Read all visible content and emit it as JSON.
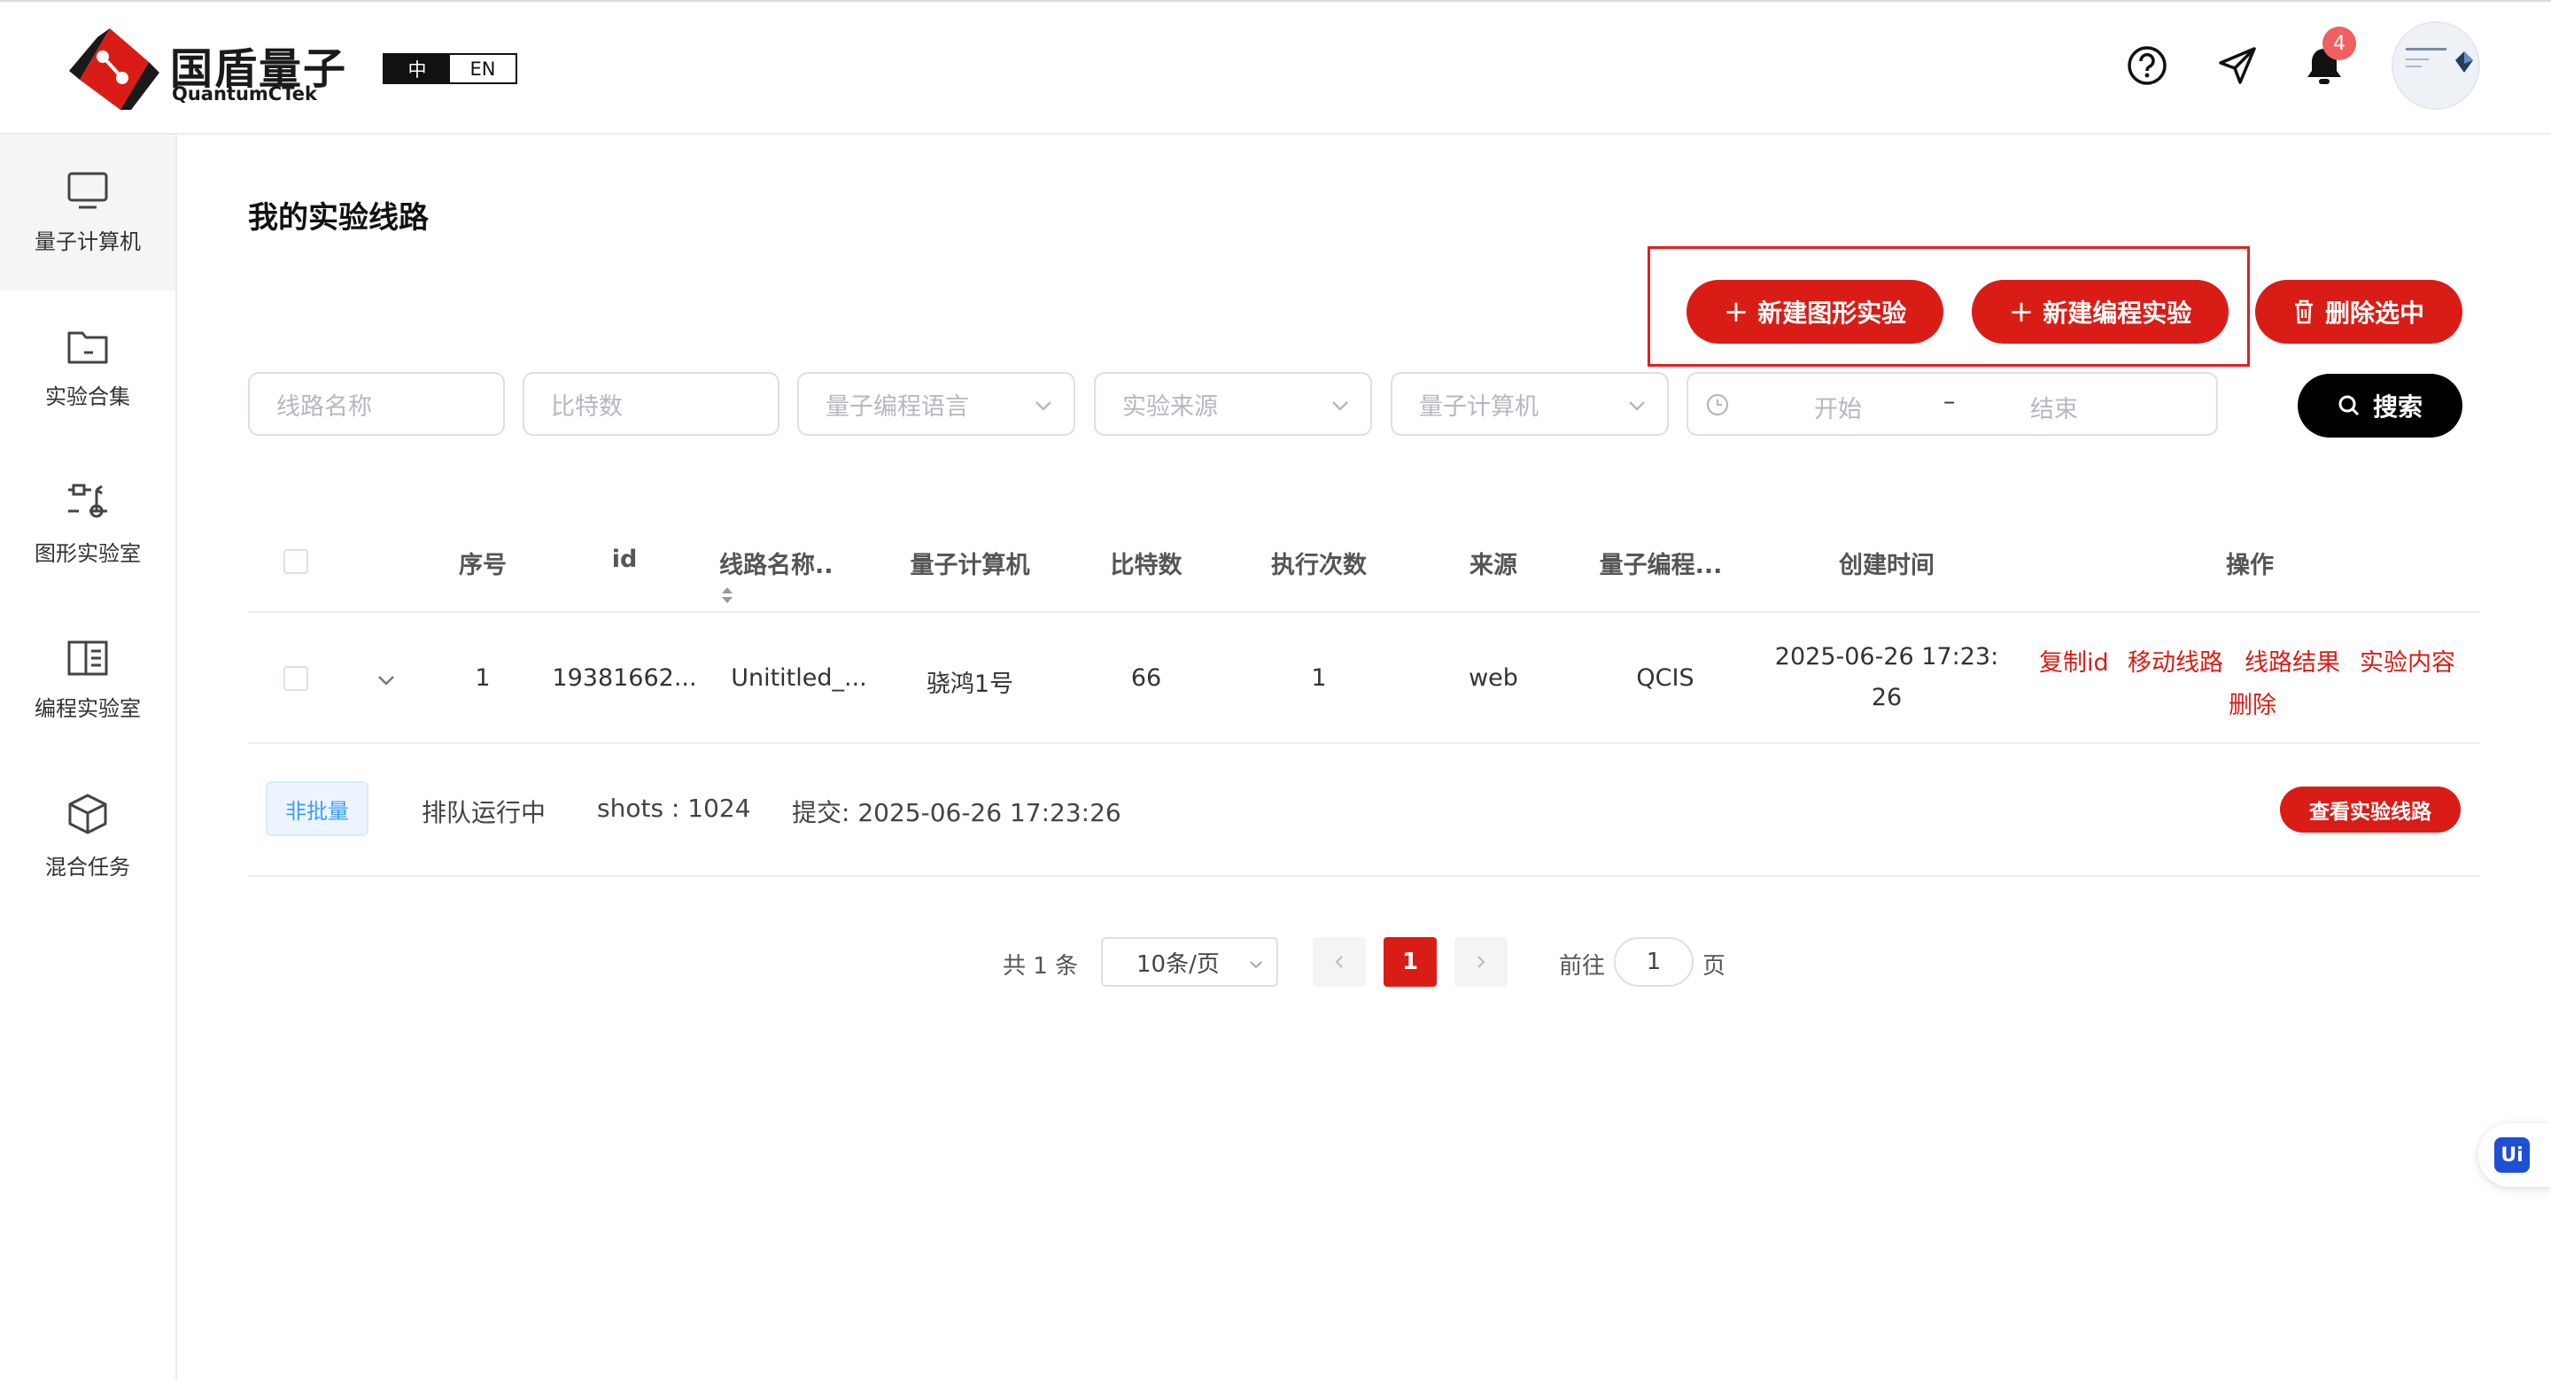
{
  "header": {
    "brand_cn": "国盾量子",
    "brand_en": "QuantumCTek",
    "lang_zh": "中",
    "lang_en": "EN",
    "notification_count": "4"
  },
  "sidebar": {
    "items": [
      {
        "label": "量子计算机",
        "icon": "monitor-icon",
        "active": true
      },
      {
        "label": "实验合集",
        "icon": "folder-icon"
      },
      {
        "label": "图形实验室",
        "icon": "circuit-icon"
      },
      {
        "label": "编程实验室",
        "icon": "code-panel-icon"
      },
      {
        "label": "混合任务",
        "icon": "cube-icon"
      }
    ]
  },
  "main": {
    "title": "我的实验线路",
    "actions": {
      "new_graphic": "新建图形实验",
      "new_program": "新建编程实验",
      "delete_selected": "删除选中"
    },
    "filters": {
      "circuit_name": "线路名称",
      "bits": "比特数",
      "language": "量子编程语言",
      "source": "实验来源",
      "computer": "量子计算机",
      "start": "开始",
      "separator": "–",
      "end": "结束",
      "search": "搜索"
    },
    "table": {
      "headers": [
        "序号",
        "id",
        "线路名称..",
        "量子计算机",
        "比特数",
        "执行次数",
        "来源",
        "量子编程...",
        "创建时间",
        "操作"
      ],
      "rows": [
        {
          "index": "1",
          "id": "19381662...",
          "name": "Unititled_...",
          "computer": "骁鸿1号",
          "bits": "66",
          "runs": "1",
          "source": "web",
          "language": "QCIS",
          "created_line1": "2025-06-26 17:23:",
          "created_line2": "26",
          "ops": [
            "复制id",
            "移动线路",
            "线路结果",
            "实验内容",
            "删除"
          ]
        }
      ],
      "detail": {
        "tag": "非批量",
        "status": "排队运行中",
        "shots": "shots : 1024",
        "submitted": "提交: 2025-06-26 17:23:26",
        "view_button": "查看实验线路"
      }
    },
    "pagination": {
      "total": "共 1 条",
      "page_size": "10条/页",
      "current": "1",
      "goto_label": "前往",
      "goto_value": "1",
      "page_unit": "页"
    }
  },
  "float_badge": "Ui",
  "colors": {
    "brand_red": "#d91d16",
    "highlight_border": "#e02020",
    "badge": "#f06060"
  }
}
